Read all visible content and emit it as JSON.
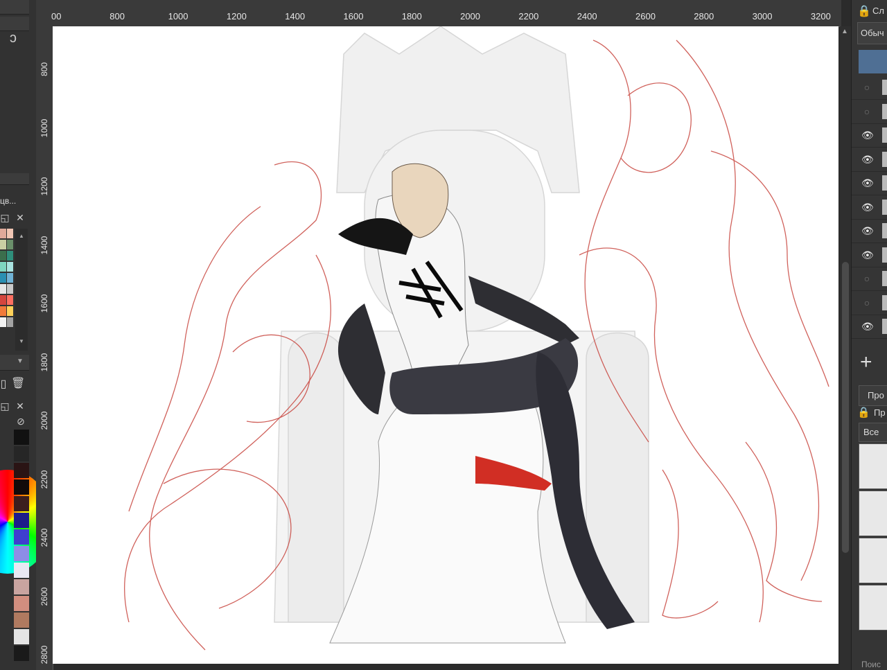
{
  "ruler": {
    "horizontal": [
      "00",
      "800",
      "1000",
      "1200",
      "1400",
      "1600",
      "1800",
      "2000",
      "2200",
      "2400",
      "2600",
      "2800",
      "3000",
      "3200"
    ],
    "vertical": [
      "800",
      "1000",
      "1200",
      "1400",
      "1600",
      "1800",
      "2000",
      "2200",
      "2400",
      "2600",
      "2800"
    ]
  },
  "left_panel": {
    "truncated_label": "цв...",
    "palette": [
      "#e0a99a",
      "#f1c6b4",
      "#c9cfa3",
      "#6a8f6a",
      "#3b6e4c",
      "#2f8f7b",
      "#7ed4c0",
      "#a9e3e0",
      "#2a8fb2",
      "#70b3d6",
      "#e7e7e7",
      "#c9c9c9",
      "#d4453e",
      "#ff6f61",
      "#f07a3a",
      "#ffd15a",
      "#f2f2f2",
      "#a3a3a3"
    ],
    "color_column": [
      "#111111",
      "#262626",
      "#2a1414",
      "#120a0a",
      "#3c1e1e",
      "#1d1d8a",
      "#3f3fcf",
      "#8d8de6",
      "#e8e8f3",
      "#c9a4a0",
      "#d28e7f",
      "#b07a60",
      "#e5e5e5",
      "#1a1a1a"
    ]
  },
  "right_panel": {
    "panel_title_partial": "Сл",
    "blend_mode": "Обыч",
    "brush_tab_label": "Про",
    "brush_panel_label": "Пр",
    "brush_filter": "Все",
    "search_partial": "Поис",
    "layers": [
      {
        "visible": false
      },
      {
        "visible": false
      },
      {
        "visible": true
      },
      {
        "visible": true
      },
      {
        "visible": true
      },
      {
        "visible": true
      },
      {
        "visible": true
      },
      {
        "visible": true
      },
      {
        "visible": false
      },
      {
        "visible": false
      },
      {
        "visible": true
      }
    ]
  },
  "colors": {
    "accent_blue": "#4f6f94",
    "sketch_red": "#c8463f"
  }
}
